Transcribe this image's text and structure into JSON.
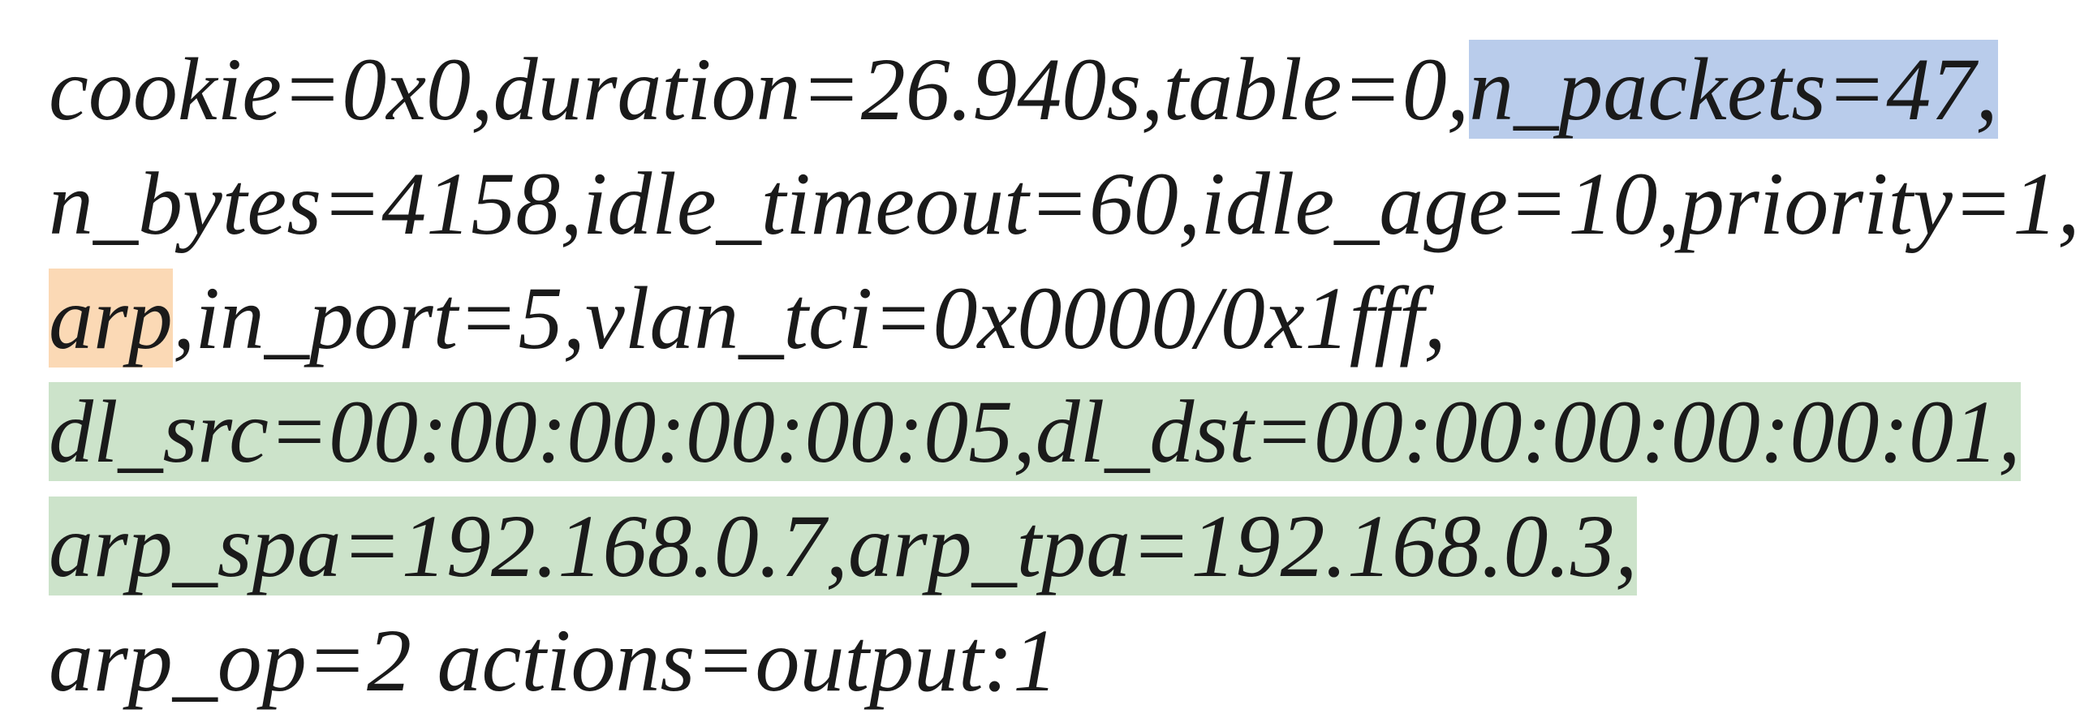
{
  "flow": {
    "line1": {
      "a": "cookie=0x0,duration=26.940s,table=0,",
      "b": "n_packets=47,"
    },
    "line2": "n_bytes=4158,idle_timeout=60,idle_age=10,priority=1,",
    "line3": {
      "a": "arp",
      "b": ",in_port=5,vlan_tci=0x0000/0x1fff,"
    },
    "line4": "dl_src=00:00:00:00:00:05,dl_dst=00:00:00:00:00:01,",
    "line5": "arp_spa=192.168.0.7,arp_tpa=192.168.0.3,",
    "line6": "arp_op=2 actions=output:1"
  },
  "parsed": {
    "cookie": "0x0",
    "duration_s": 26.94,
    "table": 0,
    "n_packets": 47,
    "n_bytes": 4158,
    "idle_timeout": 60,
    "idle_age": 10,
    "priority": 1,
    "protocol": "arp",
    "in_port": 5,
    "vlan_tci": "0x0000/0x1fff",
    "dl_src": "00:00:00:00:00:05",
    "dl_dst": "00:00:00:00:00:01",
    "arp_spa": "192.168.0.7",
    "arp_tpa": "192.168.0.3",
    "arp_op": 2,
    "actions": "output:1"
  },
  "highlights": {
    "blue": "n_packets=47,",
    "orange": "arp",
    "green_line4": "dl_src=00:00:00:00:00:05,dl_dst=00:00:00:00:00:01,",
    "green_line5": "arp_spa=192.168.0.7,arp_tpa=192.168.0.3,"
  }
}
